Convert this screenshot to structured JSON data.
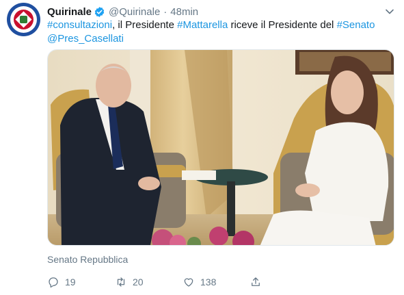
{
  "tweet": {
    "display_name": "Quirinale",
    "handle": "@Quirinale",
    "separator": "·",
    "time": "48min",
    "text_parts": [
      {
        "text": "#consultazioni",
        "link": true
      },
      {
        "text": ", il Presidente ",
        "link": false
      },
      {
        "text": "#Mattarella",
        "link": true
      },
      {
        "text": " riceve il Presidente del ",
        "link": false
      },
      {
        "text": "#Senato",
        "link": true
      },
      {
        "text": " ",
        "link": false
      },
      {
        "text": "@Pres_Casellati",
        "link": true
      }
    ],
    "location": "Senato Repubblica"
  },
  "actions": {
    "replies": "19",
    "retweets": "20",
    "likes": "138"
  },
  "icons": {
    "avatar": "quirinale-emblem-icon",
    "verified": "verified-badge-icon",
    "menu": "chevron-down-icon",
    "reply": "reply-icon",
    "retweet": "retweet-icon",
    "like": "heart-icon",
    "share": "share-icon"
  },
  "colors": {
    "link": "#1b95e0",
    "muted": "#657786",
    "verified": "#1da1f2"
  }
}
